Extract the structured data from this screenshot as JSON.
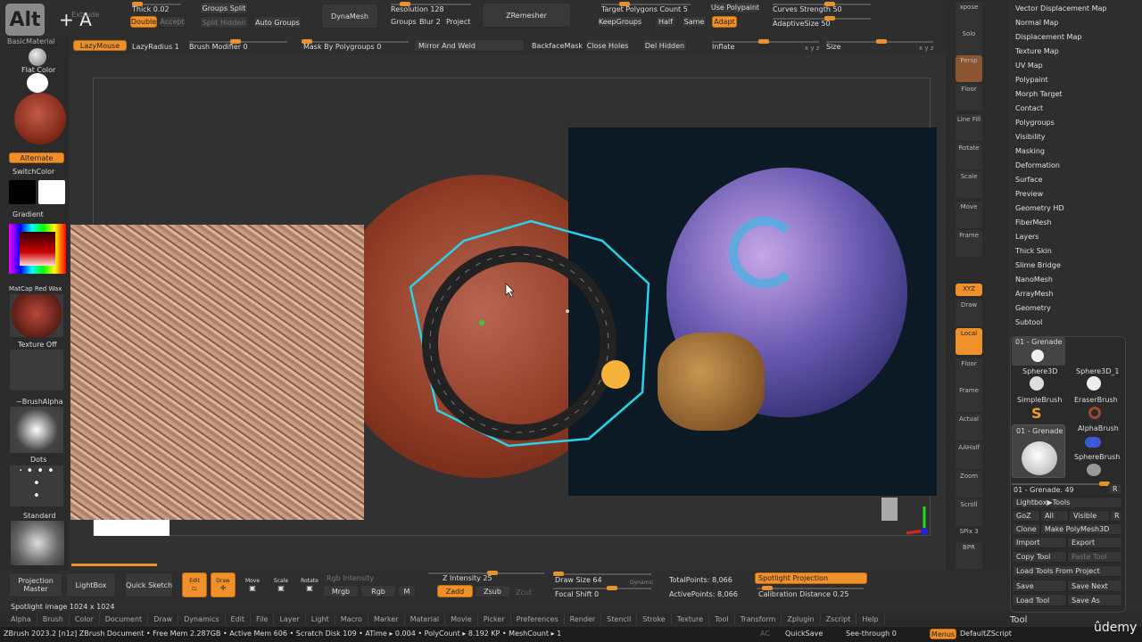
{
  "top": {
    "alt_key": "Alt",
    "plus_key": "+ A",
    "extrude": "Extrude",
    "thick": "Thick 0.02",
    "double": "Double",
    "accept": "Accept",
    "groups_split": "Groups Split",
    "split_hidden": "Split Hidden",
    "auto_groups": "Auto Groups",
    "dynamesh": "DynaMesh",
    "resolution": "Resolution 128",
    "groups": "Groups",
    "blur": "Blur 2",
    "project": "Project",
    "zremesher": "ZRemesher",
    "target_poly": "Target Polygons Count 5",
    "keepgroups": "KeepGroups",
    "half": "Half",
    "same": "Same",
    "adapt": "Adapt",
    "use_polypaint": "Use Polypaint",
    "curves_strength": "Curves Strength 50",
    "adaptive_size": "AdaptiveSize 50",
    "basic_material": "BasicMaterial",
    "lazymouse": "LazyMouse",
    "lazyradius": "LazyRadius 1",
    "brush_modifier": "Brush Modifier 0",
    "mask_by_polygroups": "Mask By Polygroups 0",
    "mirror_and_weld": "Mirror And Weld",
    "backface_mask": "BackfaceMask",
    "close_holes": "Close Holes",
    "del_hidden": "Del Hidden",
    "inflate": "Inflate",
    "size": "Size",
    "xyz_small": "x y z"
  },
  "left": {
    "flat_color": "Flat Color",
    "alternate": "Alternate",
    "switch_color": "SwitchColor",
    "gradient": "Gradient",
    "matcap": "MatCap Red Wax",
    "texture_off": "Texture Off",
    "brush_alpha": "~BrushAlpha",
    "dots": "Dots",
    "standard": "Standard"
  },
  "right_icons": [
    "xpose",
    "Solo",
    "Persp",
    "Floor",
    "Line Fill",
    "Rotate",
    "Scale",
    "Move",
    "Frame",
    "XYZ",
    "Draw",
    "Local",
    "Floor",
    "Frame",
    "Actual",
    "AAHalf",
    "Zoom",
    "Scroll",
    "SPix 3",
    "BPR"
  ],
  "right_panel": {
    "menu": [
      "Vector Displacement Map",
      "Normal Map",
      "Displacement Map",
      "Texture Map",
      "UV Map",
      "Polypaint",
      "Morph Target",
      "Contact",
      "Polygroups",
      "Visibility",
      "Masking",
      "Deformation",
      "Surface",
      "Preview",
      "Geometry HD",
      "FiberMesh",
      "Layers",
      "Thick Skin",
      "Slime Bridge",
      "NanoMesh",
      "ArrayMesh",
      "Geometry",
      "Subtool"
    ],
    "current_tool": "01 - Grenade",
    "tools": [
      "Sphere3D",
      "Sphere3D_1",
      "SimpleBrush",
      "EraserBrush",
      "AlphaBrush",
      "SphereBrush"
    ],
    "tool_slider": "01 - Grenade. 49",
    "r": "R",
    "lightbox_tools": "Lightbox▶Tools",
    "goz": "GoZ",
    "all": "All",
    "visible": "Visible",
    "clone": "Clone",
    "make_polymesh": "Make PolyMesh3D",
    "import": "Import",
    "export": "Export",
    "copy_tool": "Copy Tool",
    "paste_tool": "Paste Tool",
    "load_from_project": "Load Tools From Project",
    "save": "Save",
    "save_next": "Save Next",
    "load_tool": "Load Tool",
    "save_as": "Save As",
    "tool_title": "Tool"
  },
  "bottom": {
    "projection_master": "Projection Master",
    "lightbox": "LightBox",
    "quick_sketch": "Quick Sketch",
    "edit": "Edit",
    "draw": "Draw",
    "move": "Move",
    "scale": "Scale",
    "rotate": "Rotate",
    "rgb_intensity": "Rgb Intensity",
    "mrgb": "Mrgb",
    "rgb": "Rgb",
    "m": "M",
    "z_intensity": "Z Intensity 25",
    "zadd": "Zadd",
    "zsub": "Zsub",
    "zcut": "Zcut",
    "draw_size": "Draw Size 64",
    "dynamic": "Dynamic",
    "focal_shift": "Focal Shift 0",
    "total_points": "TotalPoints: 8,066",
    "active_points": "ActivePoints: 8,066",
    "spotlight_projection": "Spotlight Projection",
    "calibration": "Calibration Distance 0.25",
    "spotlight_image": "Spotlight image 1024 x 1024"
  },
  "menus": [
    "Alpha",
    "Brush",
    "Color",
    "Document",
    "Draw",
    "Dynamics",
    "Edit",
    "File",
    "Layer",
    "Light",
    "Macro",
    "Marker",
    "Material",
    "Movie",
    "Picker",
    "Preferences",
    "Render",
    "Stencil",
    "Stroke",
    "Texture",
    "Tool",
    "Transform",
    "Zplugin",
    "Zscript",
    "Help"
  ],
  "status": {
    "text": "ZBrush 2023.2 [n1z]  ZBrush Document   • Free Mem 2.287GB • Active Mem 606 • Scratch Disk 109 • ATime ▸ 0.004 • PolyCount ▸ 8.192 KP • MeshCount ▸ 1",
    "ac": "AC",
    "quicksave": "QuickSave",
    "see_through": "See-through 0",
    "menus": "Menus",
    "default_zscript": "DefaultZScript",
    "watermark": "ûdemy"
  },
  "colors": {
    "accent": "#f0902a",
    "spotlight_outline": "#27d3e8"
  }
}
